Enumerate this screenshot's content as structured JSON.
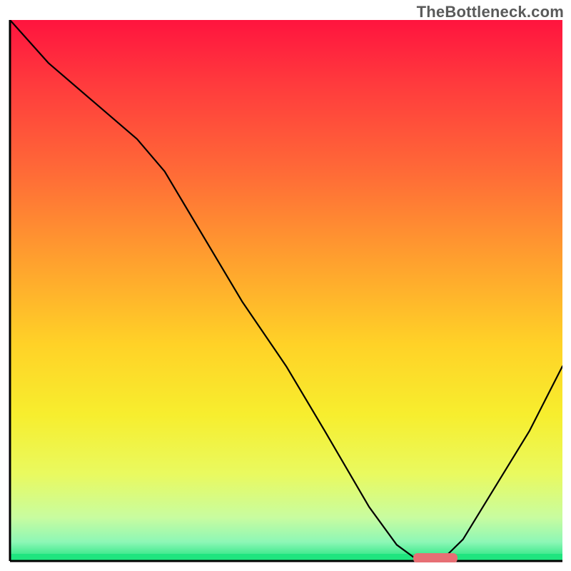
{
  "watermark": "TheBottleneck.com",
  "chart_data": {
    "type": "line",
    "title": "",
    "xlabel": "",
    "ylabel": "",
    "xlim": [
      0,
      100
    ],
    "ylim": [
      0,
      100
    ],
    "grid": false,
    "series": [
      {
        "name": "curve",
        "x": [
          0,
          7,
          15,
          23,
          28,
          35,
          42,
          50,
          57,
          65,
          70,
          74,
          78,
          82,
          88,
          94,
          100
        ],
        "y": [
          100,
          92,
          85,
          78,
          72,
          60,
          48,
          36,
          24,
          10,
          3,
          0,
          0,
          4,
          14,
          24,
          36
        ]
      }
    ],
    "marker": {
      "x": 77,
      "y": 0,
      "width": 8,
      "height": 2,
      "color": "#e66f74"
    },
    "background_gradient": {
      "stops": [
        {
          "offset": 0.0,
          "color": "#ff143e"
        },
        {
          "offset": 0.12,
          "color": "#ff3b3d"
        },
        {
          "offset": 0.28,
          "color": "#ff6a37"
        },
        {
          "offset": 0.45,
          "color": "#ffa22e"
        },
        {
          "offset": 0.6,
          "color": "#ffd227"
        },
        {
          "offset": 0.73,
          "color": "#f7ee2e"
        },
        {
          "offset": 0.84,
          "color": "#e9fa60"
        },
        {
          "offset": 0.92,
          "color": "#c8fca0"
        },
        {
          "offset": 0.965,
          "color": "#8df7b6"
        },
        {
          "offset": 1.0,
          "color": "#19e37a"
        }
      ]
    },
    "axis_color": "#000000",
    "line_color": "#000000",
    "line_width": 2.2
  }
}
